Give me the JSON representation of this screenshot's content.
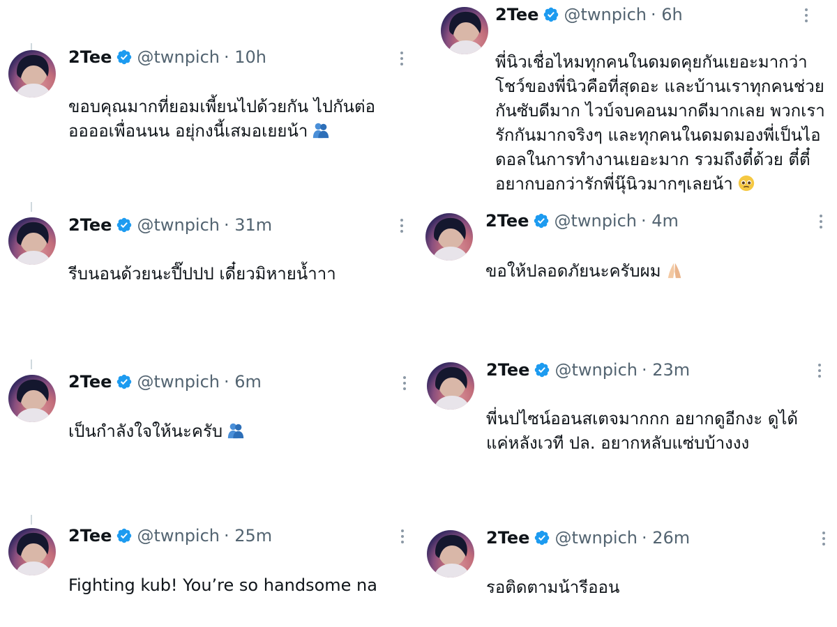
{
  "account": {
    "display_name": "2Tee",
    "handle": "@twnpich",
    "verified_icon": "verified-badge-icon",
    "verified_color": "#1d9bf0"
  },
  "tweets": [
    {
      "time": "· 10h",
      "text": "ขอบคุณมากที่ยอมเพี้ยนไปด้วยกัน ไปกันต่อ\nออออเพื่อนนน อยุ่กงนี้เสมอเยยน้า",
      "emoji": "people-hugging-emoji"
    },
    {
      "time": "· 6h",
      "text": "พี่นิวเชื่อไหมทุกคนในดมดคุยกันเยอะมากว่า\nโชว์ของพี่นิวคือที่สุดอะ และบ้านเราทุกคนช่วย\nกันซับดีมาก ไวบ์จบคอนมากดีมากเลย พวกเรา\nรักกันมากจริงๆ และทุกคนในดมดมองพี่เป็นไอ\nดอลในการทำงานเยอะมาก รวมถึงตี๋ด้วย ตี๋ตี๋\nอยากบอกว่ารักพี่นุ๊นิวมากๆเลยน้า",
      "emoji": "pleading-face-emoji"
    },
    {
      "time": "· 31m",
      "text": "รีบนอนด้วยนะปี๊ปปป เดี๋ยวมิหายน้ำาา",
      "emoji": ""
    },
    {
      "time": "· 4m",
      "text": "ขอให้ปลอดภัยนะครับผม",
      "emoji": "folded-hands-emoji"
    },
    {
      "time": "· 6m",
      "text": "เป็นกำลังใจให้นะครับ",
      "emoji": "people-hugging-emoji"
    },
    {
      "time": "· 23m",
      "text": "พี่นปไซน์ออนสเตจมากกก อยากดูอีกงะ ดูได้\nแค่หลังเวที ปล. อยากหลับแซ่บบ้างงง",
      "emoji": ""
    },
    {
      "time": "· 25m",
      "text": "Fighting kub! You’re so handsome na",
      "emoji": ""
    },
    {
      "time": "· 26m",
      "text": "รอติดตามน้ารีออน",
      "emoji": ""
    }
  ]
}
